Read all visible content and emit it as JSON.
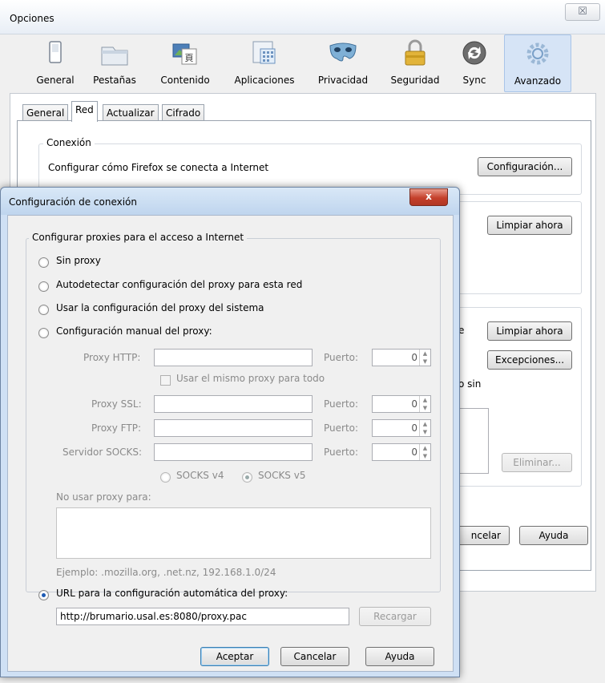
{
  "main_window": {
    "title": "Opciones",
    "close_glyph": "☒",
    "toolbar": [
      {
        "label": "General",
        "icon": "switch-icon"
      },
      {
        "label": "Pestañas",
        "icon": "tabs-icon"
      },
      {
        "label": "Contenido",
        "icon": "content-icon"
      },
      {
        "label": "Aplicaciones",
        "icon": "applications-icon"
      },
      {
        "label": "Privacidad",
        "icon": "mask-icon"
      },
      {
        "label": "Seguridad",
        "icon": "lock-icon"
      },
      {
        "label": "Sync",
        "icon": "sync-icon"
      },
      {
        "label": "Avanzado",
        "icon": "gear-icon"
      }
    ],
    "subtabs": [
      "General",
      "Red",
      "Actualizar",
      "Cifrado"
    ],
    "connection_group": {
      "legend": "Conexión",
      "description": "Configurar cómo Firefox se conecta a Internet",
      "settings_button": "Configuración..."
    },
    "buttons": {
      "clear_now_1": "Limpiar ahora",
      "clear_now_2": "Limpiar ahora",
      "exceptions": "Excepciones...",
      "remove": "Eliminar...",
      "cancel_partial": "ncelar",
      "help": "Ayuda"
    },
    "fragments": {
      "sin": "o sin",
      "e": "e"
    }
  },
  "dialog": {
    "title": "Configuración de conexión",
    "close_glyph": "x",
    "group_legend": "Configurar proxies para el acceso a Internet",
    "options": {
      "no_proxy": "Sin proxy",
      "auto_detect": "Autodetectar configuración del proxy para esta red",
      "system": "Usar la configuración del proxy del sistema",
      "manual": "Configuración manual del proxy:",
      "auto_url": "URL para la configuración automática del proxy:"
    },
    "manual": {
      "http_label": "Proxy HTTP:",
      "ssl_label": "Proxy SSL:",
      "ftp_label": "Proxy FTP:",
      "socks_label": "Servidor SOCKS:",
      "port_label": "Puerto:",
      "http_port": "0",
      "ssl_port": "0",
      "ftp_port": "0",
      "socks_port": "0",
      "same_proxy": "Usar el mismo proxy para todo",
      "socks4": "SOCKS v4",
      "socks5": "SOCKS v5",
      "no_proxy_for": "No usar proxy para:",
      "example": "Ejemplo: .mozilla.org, .net.nz, 192.168.1.0/24"
    },
    "auto_url_value": "http://brumario.usal.es:8080/proxy.pac",
    "reload_button": "Recargar",
    "buttons": {
      "accept": "Aceptar",
      "cancel": "Cancelar",
      "help": "Ayuda"
    }
  },
  "colors": {
    "dialog_title_bg": "#cfe0f4",
    "close_red": "#c4402b",
    "active_tab_bg": "#d6e4f6",
    "radio_checked": "#1d5ab3"
  }
}
